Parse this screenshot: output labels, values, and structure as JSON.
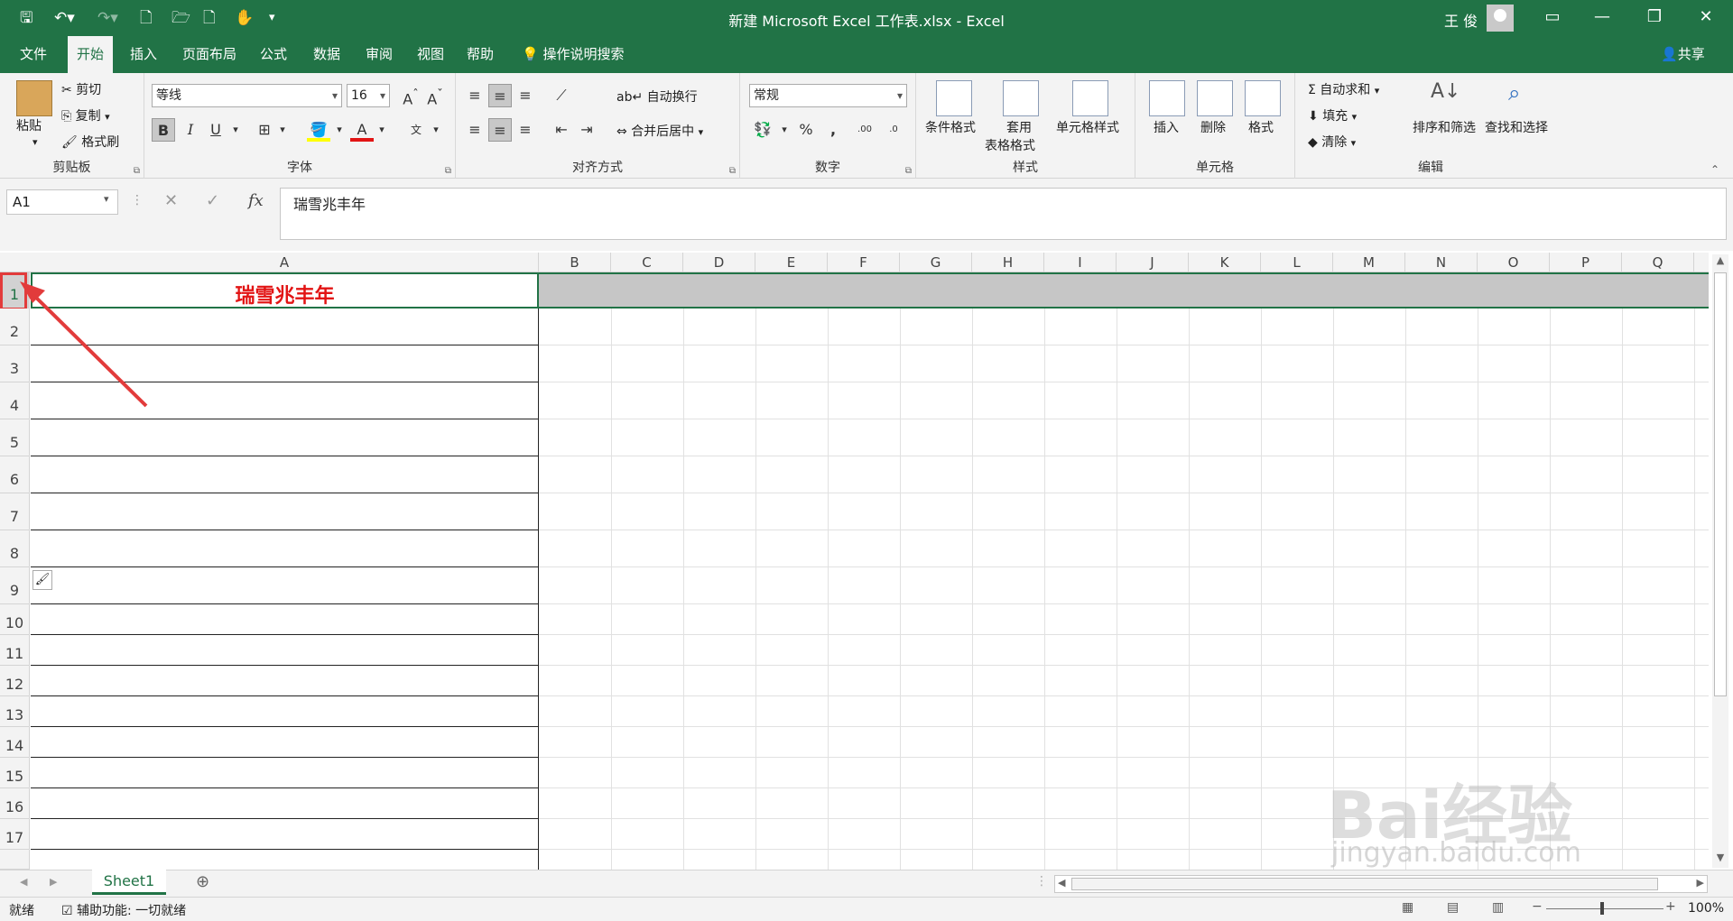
{
  "titlebar": {
    "title": "新建 Microsoft Excel 工作表.xlsx  -  Excel",
    "user": "王 俊"
  },
  "tabs": [
    "文件",
    "开始",
    "插入",
    "页面布局",
    "公式",
    "数据",
    "审阅",
    "视图",
    "帮助"
  ],
  "tell_me": "操作说明搜索",
  "share": "共享",
  "clipboard": {
    "paste": "粘贴",
    "cut": "剪切",
    "copy": "复制",
    "format_painter": "格式刷",
    "label": "剪贴板"
  },
  "font": {
    "name": "等线",
    "size": "16",
    "bold": "B",
    "italic": "I",
    "underline": "U",
    "label": "字体"
  },
  "alignment": {
    "wrap": "自动换行",
    "merge": "合并后居中",
    "label": "对齐方式"
  },
  "number": {
    "format": "常规",
    "label": "数字"
  },
  "styles": {
    "conditional": "条件格式",
    "table_format_1": "套用",
    "table_format_2": "表格格式",
    "cell_styles": "单元格样式",
    "label": "样式"
  },
  "cells": {
    "insert": "插入",
    "delete": "删除",
    "format": "格式",
    "label": "单元格"
  },
  "editing": {
    "autosum": "自动求和",
    "fill": "填充",
    "clear": "清除",
    "sort": "排序和筛选",
    "find": "查找和选择",
    "label": "编辑"
  },
  "formula_bar": {
    "name_box": "A1",
    "fx": "fx",
    "content": "瑞雪兆丰年"
  },
  "columns": [
    "A",
    "B",
    "C",
    "D",
    "E",
    "F",
    "G",
    "H",
    "I",
    "J",
    "K",
    "L",
    "M",
    "N",
    "O",
    "P",
    "Q"
  ],
  "rows": [
    "1",
    "2",
    "3",
    "4",
    "5",
    "6",
    "7",
    "8",
    "9",
    "10",
    "11",
    "12",
    "13",
    "14",
    "15",
    "16",
    "17"
  ],
  "cell_a1": "瑞雪兆丰年",
  "sheet_tab": "Sheet1",
  "status": {
    "ready": "就绪",
    "accessibility": "辅助功能: 一切就绪",
    "zoom": "100%"
  },
  "watermark": {
    "line1": "Bai经验",
    "line2": "jingyan.baidu.com"
  },
  "colors": {
    "excel_green": "#217346",
    "highlight_red": "#e21414"
  }
}
